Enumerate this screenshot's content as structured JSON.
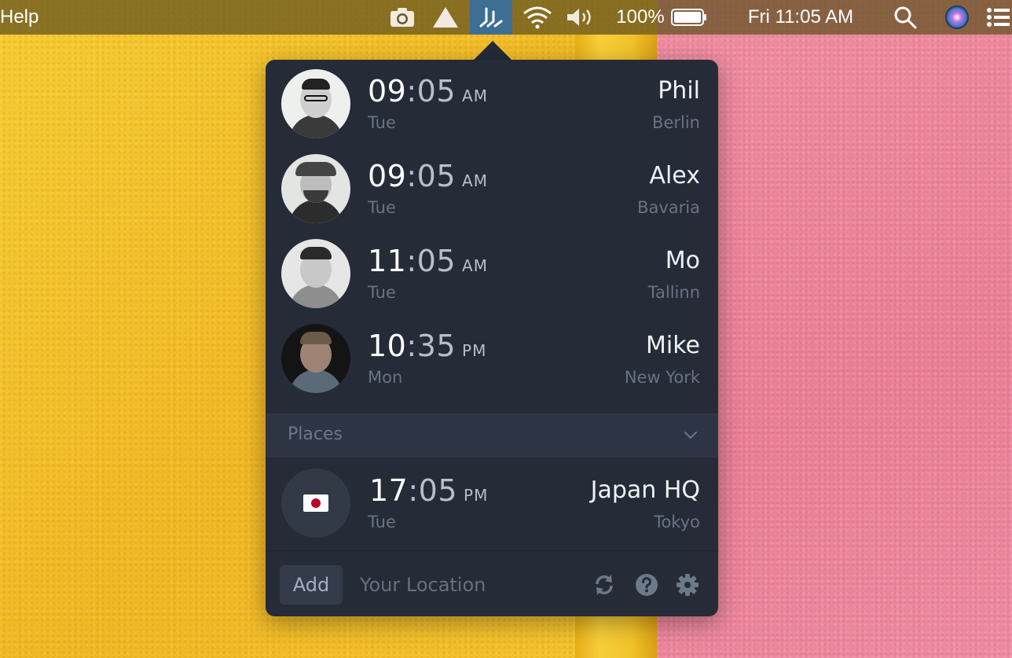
{
  "menubar": {
    "help_label": "Help",
    "battery_percent": "100%",
    "clock": "Fri 11:05 AM",
    "icons": [
      "camera-icon",
      "drive-icon",
      "timezone-app-icon",
      "wifi-icon",
      "volume-icon",
      "battery-icon",
      "search-icon",
      "siri-icon",
      "menu-list-icon"
    ]
  },
  "people": [
    {
      "hours": "09",
      "minutes": ":05",
      "ampm": "AM",
      "day": "Tue",
      "name": "Phil",
      "city": "Berlin"
    },
    {
      "hours": "09",
      "minutes": ":05",
      "ampm": "AM",
      "day": "Tue",
      "name": "Alex",
      "city": "Bavaria"
    },
    {
      "hours": "11",
      "minutes": ":05",
      "ampm": "AM",
      "day": "Tue",
      "name": "Mo",
      "city": "Tallinn"
    },
    {
      "hours": "10",
      "minutes": ":35",
      "ampm": "PM",
      "day": "Mon",
      "name": "Mike",
      "city": "New York"
    }
  ],
  "places_section": {
    "title": "Places",
    "items": [
      {
        "flag": "🇯🇵",
        "hours": "17",
        "minutes": ":05",
        "ampm": "PM",
        "day": "Tue",
        "name": "Japan HQ",
        "city": "Tokyo"
      }
    ]
  },
  "footer": {
    "add_label": "Add",
    "location_placeholder": "Your Location",
    "icons": [
      "refresh-icon",
      "help-icon",
      "settings-gear-icon"
    ]
  },
  "colors": {
    "popover_bg": "#252b37",
    "section_bg": "#2d3545",
    "menubar_active": "#3d6e93",
    "wall_yellow": "#f2c12e",
    "wall_pink": "#ee899e"
  }
}
